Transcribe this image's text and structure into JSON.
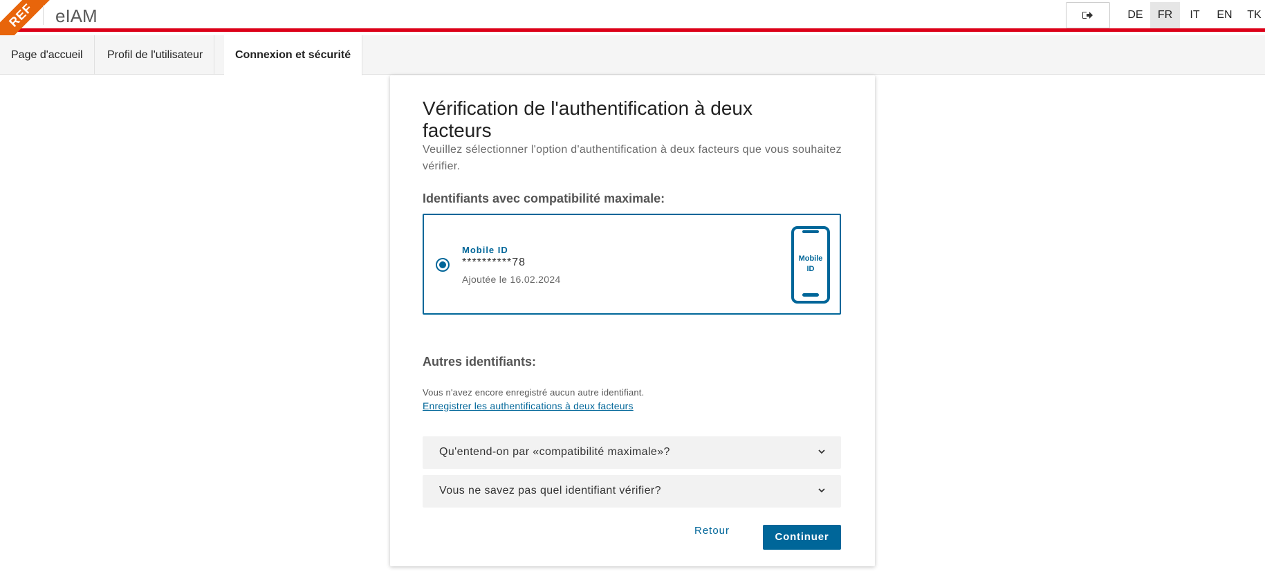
{
  "header": {
    "ribbon": "REF",
    "app_title": "eIAM",
    "logout_icon": "sign-out-icon",
    "languages": [
      "DE",
      "FR",
      "IT",
      "EN",
      "TK"
    ],
    "active_language": "FR"
  },
  "tabs": [
    {
      "label": "Page d'accueil",
      "active": false
    },
    {
      "label": "Profil de l'utilisateur",
      "active": false
    },
    {
      "label": "Connexion et sécurité",
      "active": true
    }
  ],
  "card": {
    "title": "Vérification de l'authentification à deux facteurs",
    "subtitle": "Veuillez sélectionner l'option d'authentification à deux facteurs que vous souhaitez vérifier.",
    "max_compat_heading": "Identifiants avec compatibilité maximale:",
    "option": {
      "label": "Mobile ID",
      "number": "**********78",
      "added": "Ajoutée le 16.02.2024",
      "device_text": "Mobile ID",
      "selected": true
    },
    "others_heading": "Autres identifiants:",
    "no_others_text": "Vous n'avez encore enregistré aucun autre identifiant.",
    "register_link": "Enregistrer les authentifications à deux facteurs",
    "accordions": [
      "Qu'entend-on par «compatibilité maximale»?",
      "Vous ne savez pas quel identifiant vérifier?"
    ],
    "back_label": "Retour",
    "continue_label": "Continuer"
  },
  "colors": {
    "brand_red": "#dc0018",
    "accent_blue": "#006699",
    "ribbon_orange": "#e8650b"
  }
}
